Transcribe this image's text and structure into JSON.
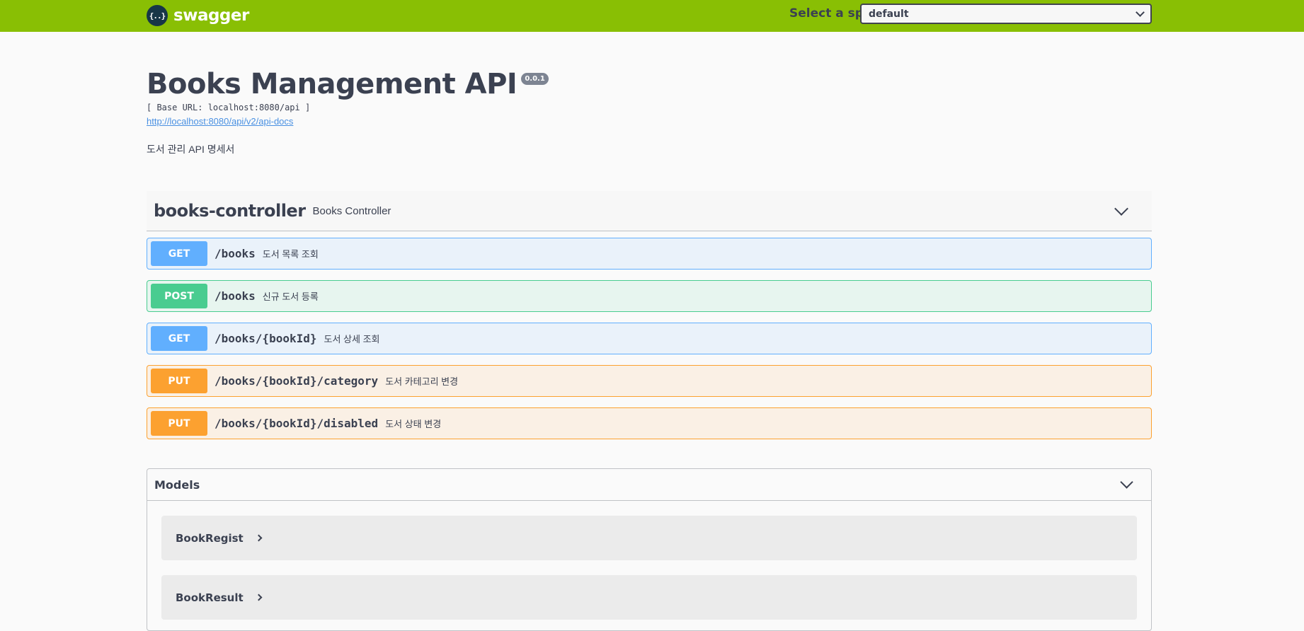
{
  "topbar": {
    "logo_glyph": "{..}",
    "logo_text": "swagger",
    "spec_label": "Select a spec",
    "spec_selected": "default"
  },
  "info": {
    "title": "Books Management API",
    "version": "0.0.1",
    "base_url": "[ Base URL: localhost:8080/api ]",
    "docs_link": "http://localhost:8080/api/v2/api-docs",
    "description": "도서 관리 API 명세서"
  },
  "controller": {
    "name": "books-controller",
    "description": "Books Controller",
    "operations": [
      {
        "method": "GET",
        "path": "/books",
        "summary": "도서 목록 조회"
      },
      {
        "method": "POST",
        "path": "/books",
        "summary": "신규 도서 등록"
      },
      {
        "method": "GET",
        "path": "/books/{bookId}",
        "summary": "도서 상세 조회"
      },
      {
        "method": "PUT",
        "path": "/books/{bookId}/category",
        "summary": "도서 카테고리 변경"
      },
      {
        "method": "PUT",
        "path": "/books/{bookId}/disabled",
        "summary": "도서 상태 변경"
      }
    ]
  },
  "models": {
    "title": "Models",
    "items": [
      {
        "name": "BookRegist"
      },
      {
        "name": "BookResult"
      }
    ]
  },
  "colors": {
    "topbar": "#89bf04",
    "get": "#61affe",
    "post": "#49cc90",
    "put": "#fca130"
  }
}
